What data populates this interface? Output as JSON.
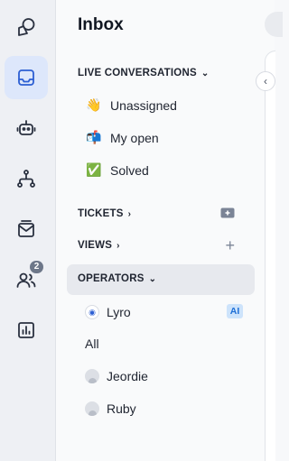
{
  "rail": {
    "items": [
      {
        "name": "shapes-icon",
        "active": false
      },
      {
        "name": "inbox-icon",
        "active": true
      },
      {
        "name": "bot-icon",
        "active": false
      },
      {
        "name": "flows-icon",
        "active": false
      },
      {
        "name": "mail-icon",
        "active": false
      },
      {
        "name": "team-icon",
        "active": false,
        "badge": "2"
      },
      {
        "name": "analytics-icon",
        "active": false
      }
    ]
  },
  "panel": {
    "title": "Inbox",
    "live": {
      "label": "LIVE CONVERSATIONS",
      "items": [
        {
          "emoji": "👋",
          "label": "Unassigned"
        },
        {
          "emoji": "📬",
          "label": "My open"
        },
        {
          "emoji": "✅",
          "label": "Solved"
        }
      ]
    },
    "tickets": {
      "label": "TICKETS",
      "action_icon": "add-ticket-icon"
    },
    "views": {
      "label": "VIEWS",
      "action_icon": "plus-icon",
      "action_glyph": "+"
    },
    "operators": {
      "label": "OPERATORS",
      "items": [
        {
          "label": "Lyro",
          "badge": "AI"
        },
        {
          "label": "All"
        },
        {
          "label": "Jeordie"
        },
        {
          "label": "Ruby"
        }
      ]
    }
  },
  "colors": {
    "accent": "#2d5fd3",
    "active_bg": "#dde7fb",
    "ai_badge_bg": "#cde3fb"
  }
}
